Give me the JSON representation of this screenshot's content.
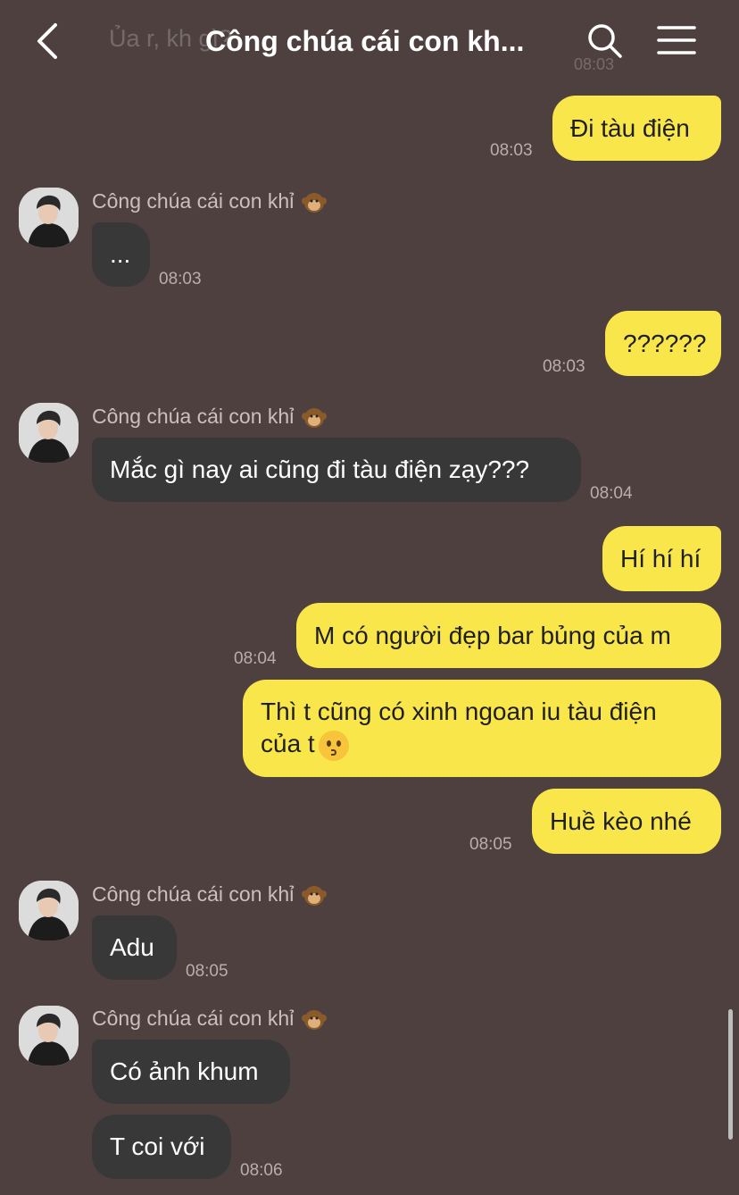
{
  "header": {
    "title": "Công chúa cái con kh...",
    "ghost_text": "Ủa r, kh                                       gì?",
    "ghost_time": "08:03"
  },
  "messages": [
    {
      "id": "m1",
      "from": "me",
      "text": "Đi tàu điện",
      "time": "08:03"
    },
    {
      "id": "m2",
      "from": "them",
      "sender": "Công chúa cái con khỉ",
      "text": "...",
      "time": "08:03"
    },
    {
      "id": "m3",
      "from": "me",
      "text": "??????",
      "time": "08:03"
    },
    {
      "id": "m4",
      "from": "them",
      "sender": "Công chúa cái con khỉ",
      "text": "Mắc gì nay ai cũng đi tàu điện zạy???",
      "time": "08:04"
    },
    {
      "id": "m5",
      "from": "me",
      "text": "Hí hí hí"
    },
    {
      "id": "m6",
      "from": "me",
      "text": "M có người đẹp bar bủng của m",
      "time": "08:04"
    },
    {
      "id": "m7",
      "from": "me",
      "text": "Thì t cũng có xinh ngoan iu tàu điện của t"
    },
    {
      "id": "m8",
      "from": "me",
      "text": "Huề kèo nhé",
      "time": "08:05"
    },
    {
      "id": "m9",
      "from": "them",
      "sender": "Công chúa cái con khỉ",
      "text": "Adu",
      "time": "08:05"
    },
    {
      "id": "m10",
      "from": "them",
      "sender": "Công chúa cái con khỉ",
      "text": "Có ảnh khum"
    },
    {
      "id": "m11",
      "from": "them",
      "text": "T coi với",
      "time": "08:06"
    }
  ],
  "icons": {
    "back": "chevron-left-icon",
    "search": "search-icon",
    "menu": "hamburger-menu-icon",
    "sender_emoji": "monkey-emoji-icon",
    "message_emoji": "kissing-face-emoji-icon"
  },
  "colors": {
    "background": "#4f4040",
    "my_bubble": "#f9e64b",
    "their_bubble": "#383838",
    "timestamp": "#b9adad"
  }
}
